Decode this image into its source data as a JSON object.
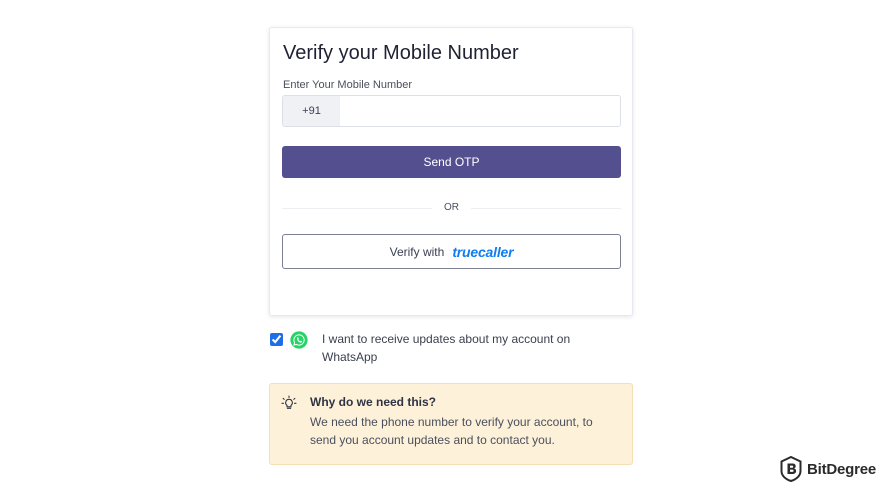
{
  "card": {
    "title": "Verify your Mobile Number",
    "field_label": "Enter Your Mobile Number",
    "country_code": "+91",
    "phone_value": "",
    "send_otp_label": "Send OTP",
    "divider_text": "OR",
    "truecaller_prefix": "Verify with",
    "truecaller_brand": "truecaller"
  },
  "whatsapp": {
    "checked": true,
    "label": "I want to receive updates about my account on WhatsApp",
    "icon": "whatsapp-icon"
  },
  "info": {
    "icon": "lightbulb-icon",
    "title": "Why do we need this?",
    "body": "We need the phone number to verify your account, to send you account updates and to contact you."
  },
  "watermark": {
    "text": "BitDegree"
  },
  "colors": {
    "primary": "#545090",
    "truecaller_blue": "#0f7ef2",
    "whatsapp_green": "#25d366",
    "info_bg": "#fdf1d9"
  }
}
